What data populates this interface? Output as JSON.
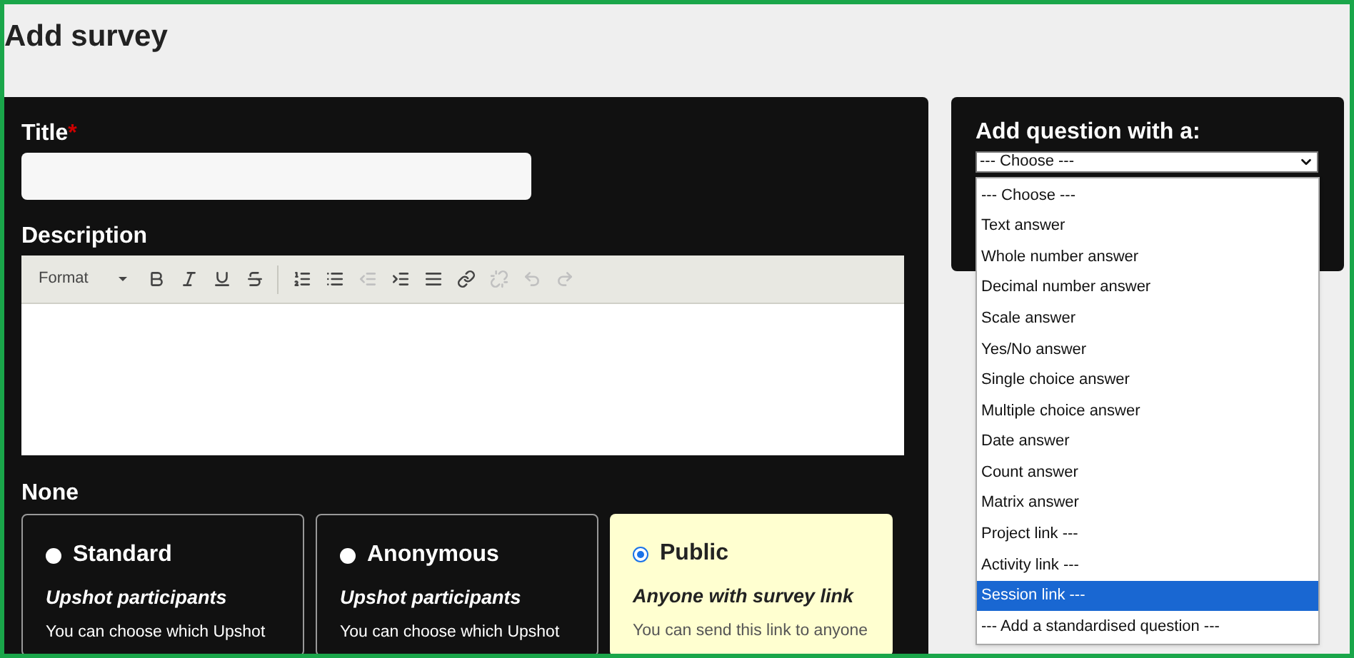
{
  "page_title": "Add survey",
  "form": {
    "title_label": "Title",
    "required_mark": "*",
    "description_label": "Description",
    "toolbar": [
      {
        "kind": "format",
        "label": "Format"
      },
      {
        "kind": "bold",
        "disabled": false
      },
      {
        "kind": "italic",
        "disabled": false
      },
      {
        "kind": "underline",
        "disabled": false
      },
      {
        "kind": "strike",
        "disabled": false
      },
      {
        "kind": "separator"
      },
      {
        "kind": "numbered",
        "disabled": false
      },
      {
        "kind": "bulleted",
        "disabled": false
      },
      {
        "kind": "outdent",
        "disabled": true
      },
      {
        "kind": "indent",
        "disabled": false
      },
      {
        "kind": "rule",
        "disabled": false
      },
      {
        "kind": "link",
        "disabled": false
      },
      {
        "kind": "unlink",
        "disabled": true
      },
      {
        "kind": "undo",
        "disabled": true
      },
      {
        "kind": "redo",
        "disabled": true
      }
    ],
    "type_label": "None",
    "types": [
      {
        "name": "Standard",
        "subtitle": "Upshot participants",
        "text": "You can choose which Upshot",
        "selected": false
      },
      {
        "name": "Anonymous",
        "subtitle": "Upshot participants",
        "text": "You can choose which Upshot",
        "selected": false
      },
      {
        "name": "Public",
        "subtitle": "Anyone with survey link",
        "text": "You can send this link to anyone",
        "selected": true
      }
    ]
  },
  "question_panel": {
    "label": "Add question with a:",
    "value": "--- Choose ---",
    "options": [
      {
        "label": "--- Choose ---",
        "highlighted": false
      },
      {
        "label": "Text answer",
        "highlighted": false
      },
      {
        "label": "Whole number answer",
        "highlighted": false
      },
      {
        "label": "Decimal number answer",
        "highlighted": false
      },
      {
        "label": "Scale answer",
        "highlighted": false
      },
      {
        "label": "Yes/No answer",
        "highlighted": false
      },
      {
        "label": "Single choice answer",
        "highlighted": false
      },
      {
        "label": "Multiple choice answer",
        "highlighted": false
      },
      {
        "label": "Date answer",
        "highlighted": false
      },
      {
        "label": "Count answer",
        "highlighted": false
      },
      {
        "label": "Matrix answer",
        "highlighted": false
      },
      {
        "label": "Project link ---",
        "highlighted": false
      },
      {
        "label": "Activity link ---",
        "highlighted": false
      },
      {
        "label": "Session link ---",
        "highlighted": true
      },
      {
        "label": "--- Add a standardised question ---",
        "highlighted": false
      }
    ]
  }
}
